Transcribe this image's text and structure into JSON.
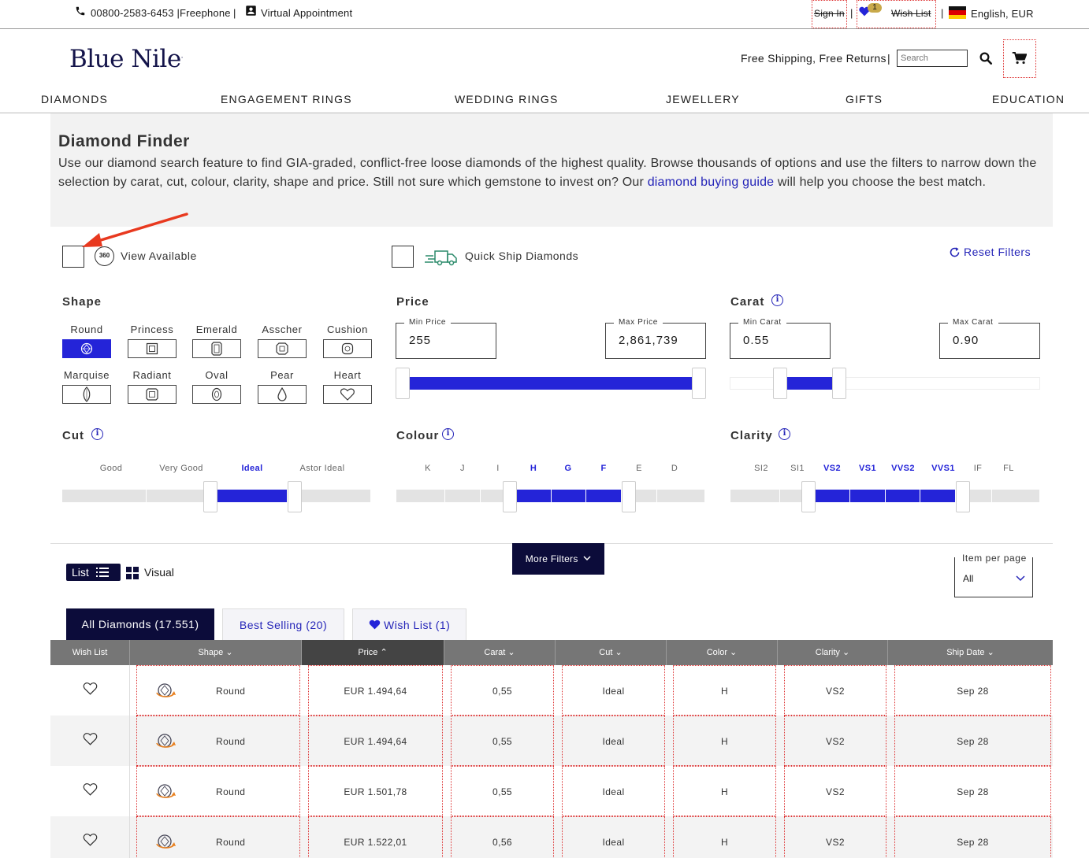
{
  "topbar": {
    "phone": "00800-2583-6453 |Freephone",
    "appointment": "Virtual Appointment",
    "sign_in": "Sign In",
    "wish_count": "1",
    "wish_list": "Wish List",
    "locale": "English, EUR"
  },
  "header": {
    "logo": "Blue Nile",
    "shipping": "Free Shipping, Free Returns",
    "search_placeholder": "Search"
  },
  "nav": [
    "DIAMONDS",
    "ENGAGEMENT RINGS",
    "WEDDING RINGS",
    "JEWELLERY",
    "GIFTS",
    "EDUCATION"
  ],
  "intro": {
    "title": "Diamond Finder",
    "text_before": "Use our diamond search feature to find GIA-graded, conflict-free loose diamonds of the highest quality. Browse thousands of options and use the filters to narrow down the selection by carat, cut, colour, clarity, shape and price. Still not sure which gemstone to invest on? Our ",
    "link": "diamond buying guide",
    "text_after": " will help you choose the best match."
  },
  "toggles": {
    "view_360_badge": "360",
    "view_available": "View Available",
    "quick_ship": "Quick Ship Diamonds",
    "reset": "Reset Filters"
  },
  "shape": {
    "title": "Shape",
    "items": [
      "Round",
      "Princess",
      "Emerald",
      "Asscher",
      "Cushion",
      "Marquise",
      "Radiant",
      "Oval",
      "Pear",
      "Heart"
    ],
    "selected": "Round"
  },
  "price": {
    "title": "Price",
    "min_label": "Min Price",
    "min_value": "255",
    "max_label": "Max Price",
    "max_value": "2,861,739"
  },
  "carat": {
    "title": "Carat",
    "min_label": "Min Carat",
    "min_value": "0.55",
    "max_label": "Max Carat",
    "max_value": "0.90"
  },
  "cut": {
    "title": "Cut",
    "grades": [
      "Good",
      "Very Good",
      "Ideal",
      "Astor Ideal"
    ],
    "selected": [
      "Ideal"
    ]
  },
  "colour": {
    "title": "Colour",
    "grades": [
      "K",
      "J",
      "I",
      "H",
      "G",
      "F",
      "E",
      "D"
    ],
    "selected": [
      "H",
      "G",
      "F"
    ]
  },
  "clarity": {
    "title": "Clarity",
    "grades": [
      "SI2",
      "SI1",
      "VS2",
      "VS1",
      "VVS2",
      "VVS1",
      "IF",
      "FL"
    ],
    "selected": [
      "VS2",
      "VS1",
      "VVS2",
      "VVS1"
    ]
  },
  "view": {
    "list": "List",
    "visual": "Visual",
    "more_filters": "More Filters",
    "per_page_label": "Item per page",
    "per_page_value": "All"
  },
  "tabs": {
    "all": "All Diamonds (17.551)",
    "best": "Best Selling (20)",
    "wish": "Wish List (1)"
  },
  "table": {
    "columns": [
      "Wish List",
      "Shape",
      "Price",
      "Carat",
      "Cut",
      "Color",
      "Clarity",
      "Ship Date"
    ],
    "rows": [
      {
        "shape": "Round",
        "price": "EUR 1.494,64",
        "carat": "0,55",
        "cut": "Ideal",
        "color": "H",
        "clarity": "VS2",
        "ship": "Sep 28"
      },
      {
        "shape": "Round",
        "price": "EUR 1.494,64",
        "carat": "0,55",
        "cut": "Ideal",
        "color": "H",
        "clarity": "VS2",
        "ship": "Sep 28"
      },
      {
        "shape": "Round",
        "price": "EUR 1.501,78",
        "carat": "0,55",
        "cut": "Ideal",
        "color": "H",
        "clarity": "VS2",
        "ship": "Sep 28"
      },
      {
        "shape": "Round",
        "price": "EUR 1.522,01",
        "carat": "0,56",
        "cut": "Ideal",
        "color": "H",
        "clarity": "VS2",
        "ship": "Sep 28"
      }
    ]
  },
  "colors": {
    "brand_navy": "#0c0c3a",
    "accent_blue": "#2424d8",
    "annotation_red": "#e8391f"
  }
}
